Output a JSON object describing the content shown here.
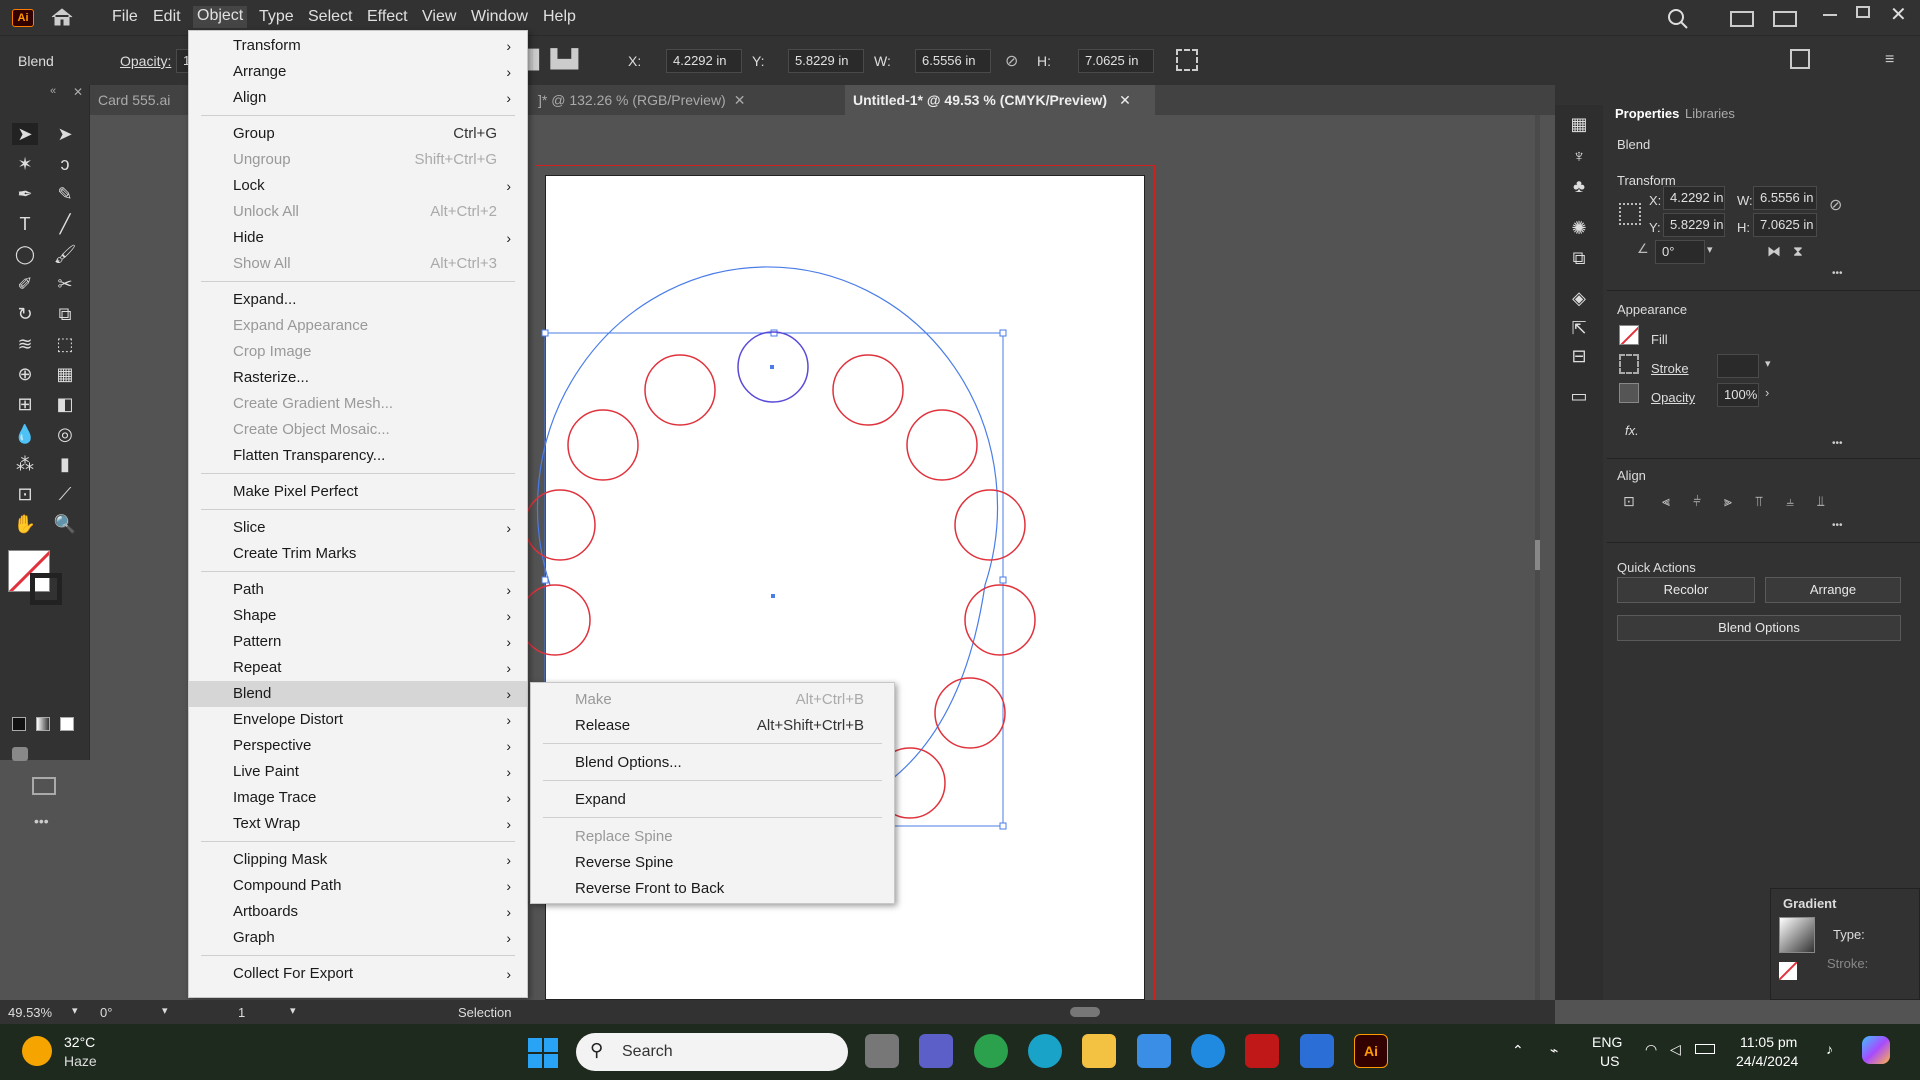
{
  "app": {
    "logo": "Ai"
  },
  "menubar": {
    "items": [
      "File",
      "Edit",
      "Object",
      "Type",
      "Select",
      "Effect",
      "View",
      "Window",
      "Help"
    ]
  },
  "controlbar": {
    "selection_label": "Blend",
    "opacity_label": "Opacity:",
    "opacity_value": "10",
    "x_label": "X:",
    "x_value": "4.2292 in",
    "y_label": "Y:",
    "y_value": "5.8229 in",
    "w_label": "W:",
    "w_value": "6.5556 in",
    "h_label": "H:",
    "h_value": "7.0625 in"
  },
  "tabs": [
    {
      "label": "Card 555.ai @"
    },
    {
      "label": "]* @ 132.26 % (RGB/Preview)"
    },
    {
      "label": "Untitled-1* @ 49.53 % (CMYK/Preview)"
    }
  ],
  "object_menu": {
    "items": [
      {
        "label": "Transform",
        "shortcut": "",
        "submenu": true,
        "disabled": false
      },
      {
        "label": "Arrange",
        "shortcut": "",
        "submenu": true,
        "disabled": false
      },
      {
        "label": "Align",
        "shortcut": "",
        "submenu": true,
        "disabled": false
      },
      {
        "label": "Group",
        "shortcut": "Ctrl+G",
        "submenu": false,
        "disabled": false
      },
      {
        "label": "Ungroup",
        "shortcut": "Shift+Ctrl+G",
        "submenu": false,
        "disabled": true
      },
      {
        "label": "Lock",
        "shortcut": "",
        "submenu": true,
        "disabled": false
      },
      {
        "label": "Unlock All",
        "shortcut": "Alt+Ctrl+2",
        "submenu": false,
        "disabled": true
      },
      {
        "label": "Hide",
        "shortcut": "",
        "submenu": true,
        "disabled": false
      },
      {
        "label": "Show All",
        "shortcut": "Alt+Ctrl+3",
        "submenu": false,
        "disabled": true
      },
      {
        "label": "Expand...",
        "shortcut": "",
        "submenu": false,
        "disabled": false
      },
      {
        "label": "Expand Appearance",
        "shortcut": "",
        "submenu": false,
        "disabled": true
      },
      {
        "label": "Crop Image",
        "shortcut": "",
        "submenu": false,
        "disabled": true
      },
      {
        "label": "Rasterize...",
        "shortcut": "",
        "submenu": false,
        "disabled": false
      },
      {
        "label": "Create Gradient Mesh...",
        "shortcut": "",
        "submenu": false,
        "disabled": true
      },
      {
        "label": "Create Object Mosaic...",
        "shortcut": "",
        "submenu": false,
        "disabled": true
      },
      {
        "label": "Flatten Transparency...",
        "shortcut": "",
        "submenu": false,
        "disabled": false
      },
      {
        "label": "Make Pixel Perfect",
        "shortcut": "",
        "submenu": false,
        "disabled": false
      },
      {
        "label": "Slice",
        "shortcut": "",
        "submenu": true,
        "disabled": false
      },
      {
        "label": "Create Trim Marks",
        "shortcut": "",
        "submenu": false,
        "disabled": false
      },
      {
        "label": "Path",
        "shortcut": "",
        "submenu": true,
        "disabled": false
      },
      {
        "label": "Shape",
        "shortcut": "",
        "submenu": true,
        "disabled": false
      },
      {
        "label": "Pattern",
        "shortcut": "",
        "submenu": true,
        "disabled": false
      },
      {
        "label": "Repeat",
        "shortcut": "",
        "submenu": true,
        "disabled": false
      },
      {
        "label": "Blend",
        "shortcut": "",
        "submenu": true,
        "disabled": false
      },
      {
        "label": "Envelope Distort",
        "shortcut": "",
        "submenu": true,
        "disabled": false
      },
      {
        "label": "Perspective",
        "shortcut": "",
        "submenu": true,
        "disabled": false
      },
      {
        "label": "Live Paint",
        "shortcut": "",
        "submenu": true,
        "disabled": false
      },
      {
        "label": "Image Trace",
        "shortcut": "",
        "submenu": true,
        "disabled": false
      },
      {
        "label": "Text Wrap",
        "shortcut": "",
        "submenu": true,
        "disabled": false
      },
      {
        "label": "Clipping Mask",
        "shortcut": "",
        "submenu": true,
        "disabled": false
      },
      {
        "label": "Compound Path",
        "shortcut": "",
        "submenu": true,
        "disabled": false
      },
      {
        "label": "Artboards",
        "shortcut": "",
        "submenu": true,
        "disabled": false
      },
      {
        "label": "Graph",
        "shortcut": "",
        "submenu": true,
        "disabled": false
      },
      {
        "label": "Collect For Export",
        "shortcut": "",
        "submenu": true,
        "disabled": false
      }
    ]
  },
  "blend_submenu": {
    "items": [
      {
        "label": "Make",
        "shortcut": "Alt+Ctrl+B",
        "disabled": true
      },
      {
        "label": "Release",
        "shortcut": "Alt+Shift+Ctrl+B",
        "disabled": false
      },
      {
        "label": "Blend Options...",
        "shortcut": "",
        "disabled": false
      },
      {
        "label": "Expand",
        "shortcut": "",
        "disabled": false
      },
      {
        "label": "Replace Spine",
        "shortcut": "",
        "disabled": true
      },
      {
        "label": "Reverse Spine",
        "shortcut": "",
        "disabled": false
      },
      {
        "label": "Reverse Front to Back",
        "shortcut": "",
        "disabled": false
      }
    ]
  },
  "properties_panel": {
    "tabs": [
      "Properties",
      "Libraries"
    ],
    "selection": "Blend",
    "transform_title": "Transform",
    "x_label": "X:",
    "x_value": "4.2292 in",
    "y_label": "Y:",
    "y_value": "5.8229 in",
    "w_label": "W:",
    "w_value": "6.5556 in",
    "h_label": "H:",
    "h_value": "7.0625 in",
    "angle_value": "0°",
    "appearance_title": "Appearance",
    "fill_label": "Fill",
    "stroke_label": "Stroke",
    "opacity_label": "Opacity",
    "opacity_value": "100%",
    "fx_label": "fx.",
    "align_title": "Align",
    "quick_actions_title": "Quick Actions",
    "recolor_label": "Recolor",
    "arrange_label": "Arrange",
    "blend_options_label": "Blend Options"
  },
  "gradient_panel": {
    "title": "Gradient",
    "type_label": "Type:",
    "stroke_label": "Stroke:"
  },
  "statusbar": {
    "zoom": "49.53%",
    "rotation": "0°",
    "artboard": "1",
    "tool": "Selection"
  },
  "taskbar": {
    "weather_temp": "32°C",
    "weather_desc": "Haze",
    "search_placeholder": "Search",
    "lang_line1": "ENG",
    "lang_line2": "US",
    "time": "11:05 pm",
    "date": "24/4/2024"
  },
  "colors": {
    "stroke_red": "#e0323c",
    "spine_blue": "#4a7de8"
  }
}
